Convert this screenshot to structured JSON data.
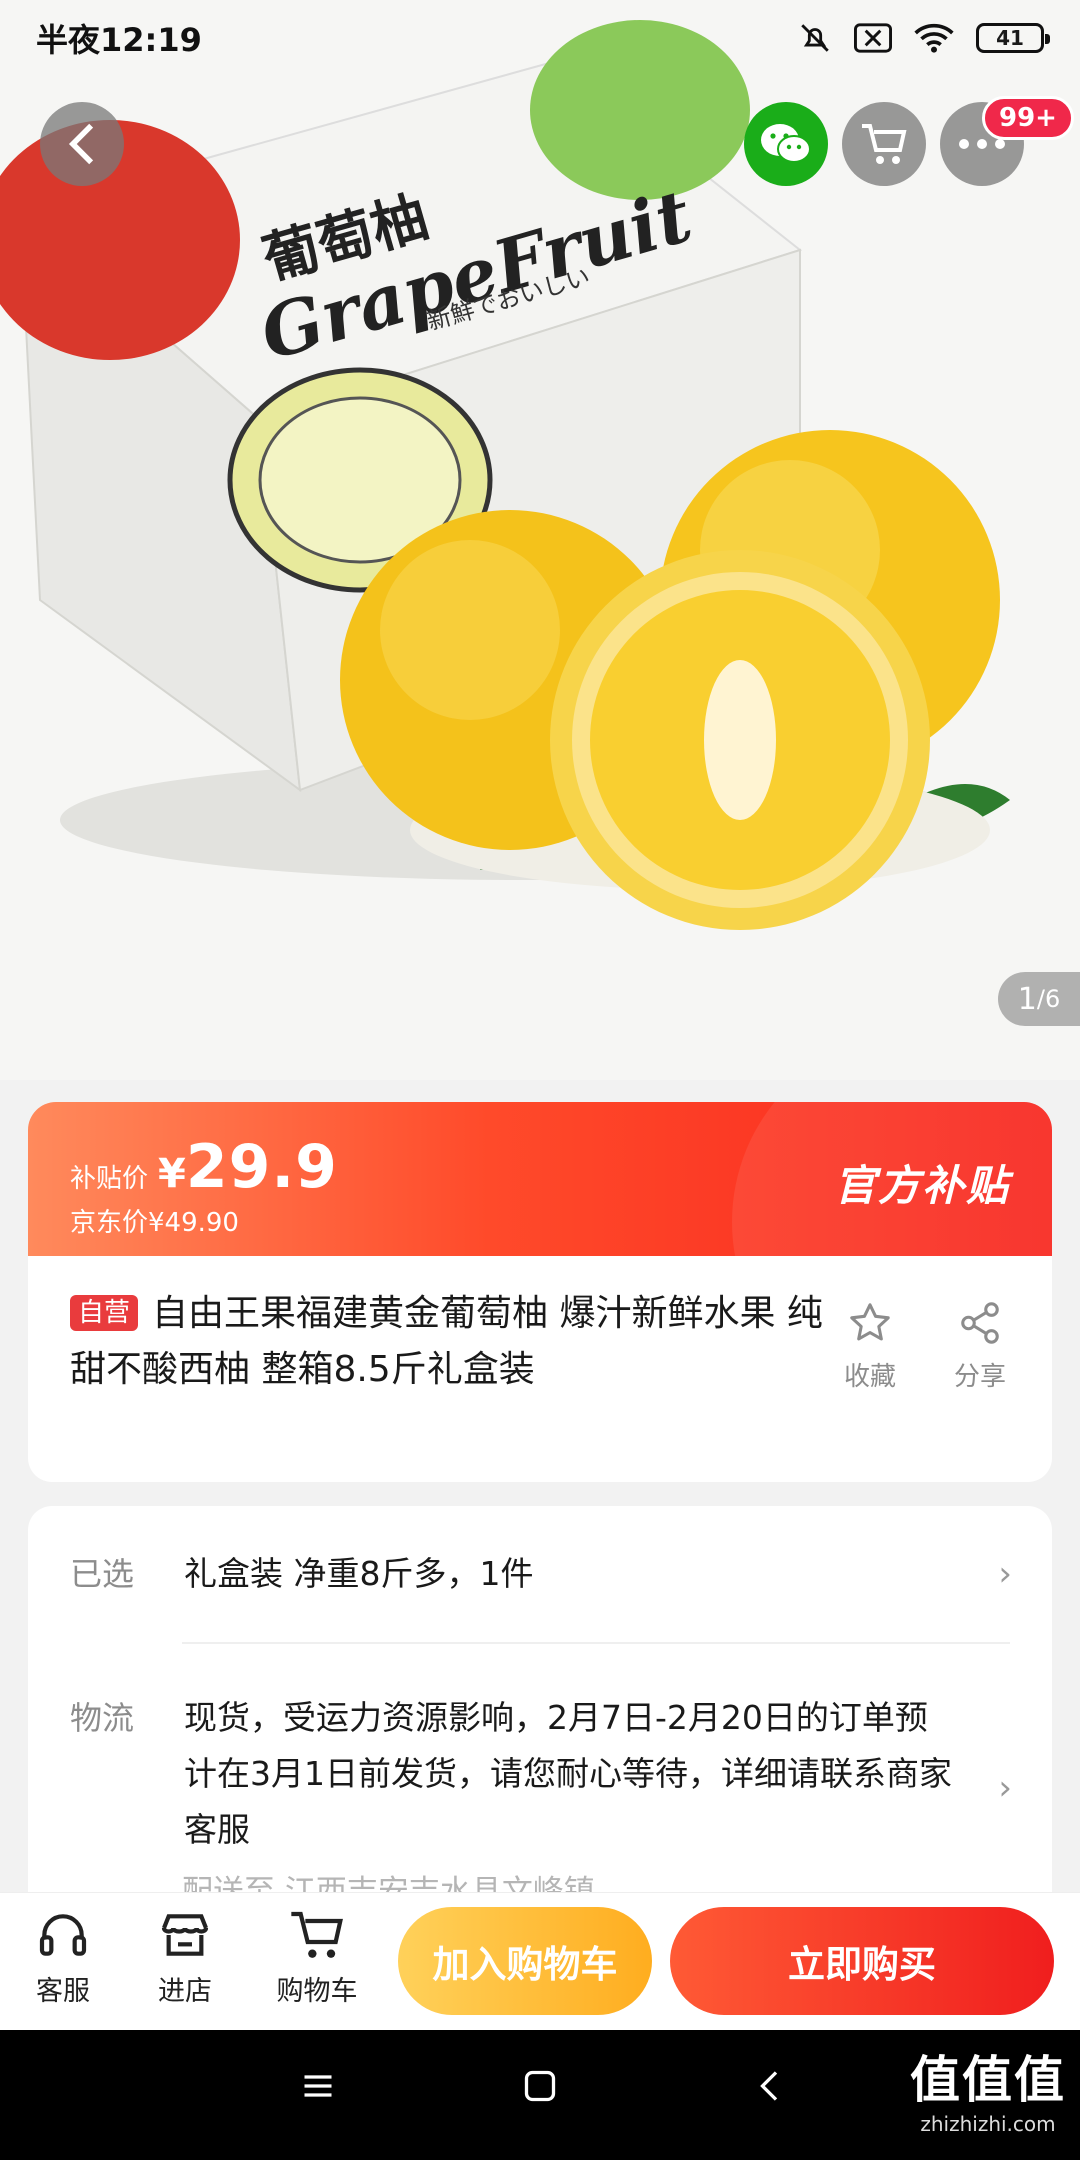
{
  "status_bar": {
    "time": "半夜12:19",
    "battery": "41"
  },
  "header": {
    "more_badge": "99+"
  },
  "product_image": {
    "box_brand_cn": "葡萄柚",
    "box_brand_en": "GrapeFruit",
    "box_tagline": "新鮮でおいしい",
    "page_current": "1",
    "page_total": "/6"
  },
  "price": {
    "label": "补贴价",
    "currency": "¥",
    "value": "29.9",
    "original": "京东价¥49.90",
    "subsidy_tag": "官方补贴"
  },
  "product": {
    "self_tag": "自营",
    "title": "自由王果福建黄金葡萄柚 爆汁新鲜水果 纯甜不酸西柚 整箱8.5斤礼盒装",
    "favorite_label": "收藏",
    "share_label": "分享"
  },
  "spec": {
    "selected_key": "已选",
    "selected_value": "礼盒装 净重8斤多，1件",
    "logistics_key": "物流",
    "logistics_value": "现货，受运力资源影响，2月7日-2月20日的订单预计在3月1日前发货，请您耐心等待，详细请联系商家客服",
    "delivery_partial": "配送至 江西吉安吉水县文峰镇"
  },
  "bottom_bar": {
    "service": "客服",
    "shop": "进店",
    "cart": "购物车",
    "add_to_cart": "加入购物车",
    "buy_now": "立即购买"
  },
  "watermark": {
    "main": "值值值",
    "sub": "zhizhizhi.com"
  },
  "colors": {
    "accent_red": "#f01e1e",
    "cart_yellow": "#ffad1f",
    "wechat_green": "#1aad19"
  }
}
